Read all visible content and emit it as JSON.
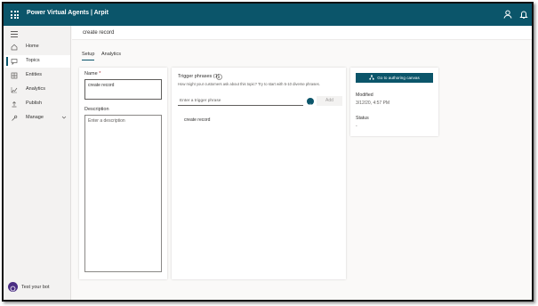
{
  "app": {
    "title": "Power Virtual Agents | Arpit"
  },
  "sidebar": {
    "items": [
      {
        "label": "Home",
        "icon": "home-icon"
      },
      {
        "label": "Topics",
        "icon": "topics-icon",
        "active": true
      },
      {
        "label": "Entities",
        "icon": "entities-icon"
      },
      {
        "label": "Analytics",
        "icon": "analytics-icon"
      },
      {
        "label": "Publish",
        "icon": "publish-icon"
      },
      {
        "label": "Manage",
        "icon": "gear-icon",
        "expandable": true
      }
    ],
    "test_bot": "Test your bot"
  },
  "page": {
    "title": "create record"
  },
  "tabs": [
    {
      "label": "Setup",
      "active": true
    },
    {
      "label": "Analytics"
    }
  ],
  "form": {
    "name_label": "Name",
    "name_required": "*",
    "name_value": "create record",
    "description_label": "Description",
    "description_placeholder": "Enter a description"
  },
  "trigger": {
    "title": "Trigger phrases (1)",
    "description": "How might your customers ask about this topic? Try to start with 5-10 diverse phrases.",
    "input_placeholder": "Enter a trigger phrase",
    "add_label": "Add",
    "phrases": [
      "create record"
    ]
  },
  "details": {
    "canvas_button": "Go to authoring canvas",
    "modified_label": "Modified",
    "modified_value": "3/12/20, 4:57 PM",
    "status_label": "Status",
    "status_value": "-"
  },
  "colors": {
    "accent": "#0b556a",
    "bot": "#4b2e83"
  }
}
